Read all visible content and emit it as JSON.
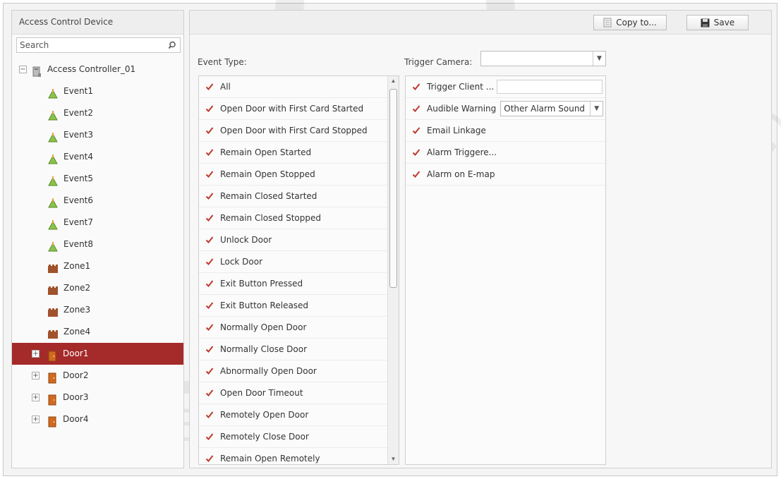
{
  "sidebar": {
    "title": "Access Control Device",
    "search_placeholder": "Search",
    "tree": [
      {
        "label": "Access Controller_01",
        "type": "controller",
        "expander": "−"
      },
      {
        "label": "Event1",
        "type": "event"
      },
      {
        "label": "Event2",
        "type": "event"
      },
      {
        "label": "Event3",
        "type": "event"
      },
      {
        "label": "Event4",
        "type": "event"
      },
      {
        "label": "Event5",
        "type": "event"
      },
      {
        "label": "Event6",
        "type": "event"
      },
      {
        "label": "Event7",
        "type": "event"
      },
      {
        "label": "Event8",
        "type": "event"
      },
      {
        "label": "Zone1",
        "type": "zone"
      },
      {
        "label": "Zone2",
        "type": "zone"
      },
      {
        "label": "Zone3",
        "type": "zone"
      },
      {
        "label": "Zone4",
        "type": "zone"
      },
      {
        "label": "Door1",
        "type": "door",
        "expander": "+",
        "selected": true
      },
      {
        "label": "Door2",
        "type": "door",
        "expander": "+"
      },
      {
        "label": "Door3",
        "type": "door",
        "expander": "+"
      },
      {
        "label": "Door4",
        "type": "door",
        "expander": "+"
      }
    ]
  },
  "toolbar": {
    "copy_label": "Copy to...",
    "save_label": "Save"
  },
  "event_type": {
    "label": "Event Type:",
    "items": [
      "All",
      "Open Door with First Card Started",
      "Open Door with First Card Stopped",
      "Remain Open Started",
      "Remain Open Stopped",
      "Remain Closed Started",
      "Remain Closed Stopped",
      "Unlock Door",
      "Lock Door",
      "Exit Button Pressed",
      "Exit Button Released",
      "Normally Open Door",
      "Normally Close Door",
      "Abnormally Open Door",
      "Open Door Timeout",
      "Remotely Open Door",
      "Remotely Close Door",
      "Remain Open Remotely"
    ]
  },
  "trigger_camera": {
    "label": "Trigger Camera:",
    "value": ""
  },
  "linkage": {
    "trigger_client": "Trigger Client ...",
    "audible_warning": "Audible Warning",
    "audible_sound": "Other Alarm Sound",
    "email_linkage": "Email Linkage",
    "alarm_triggered": "Alarm Triggere...",
    "alarm_emap": "Alarm on E-map"
  },
  "colors": {
    "selected_row": "#a52a2a",
    "check": "#c0392b"
  }
}
